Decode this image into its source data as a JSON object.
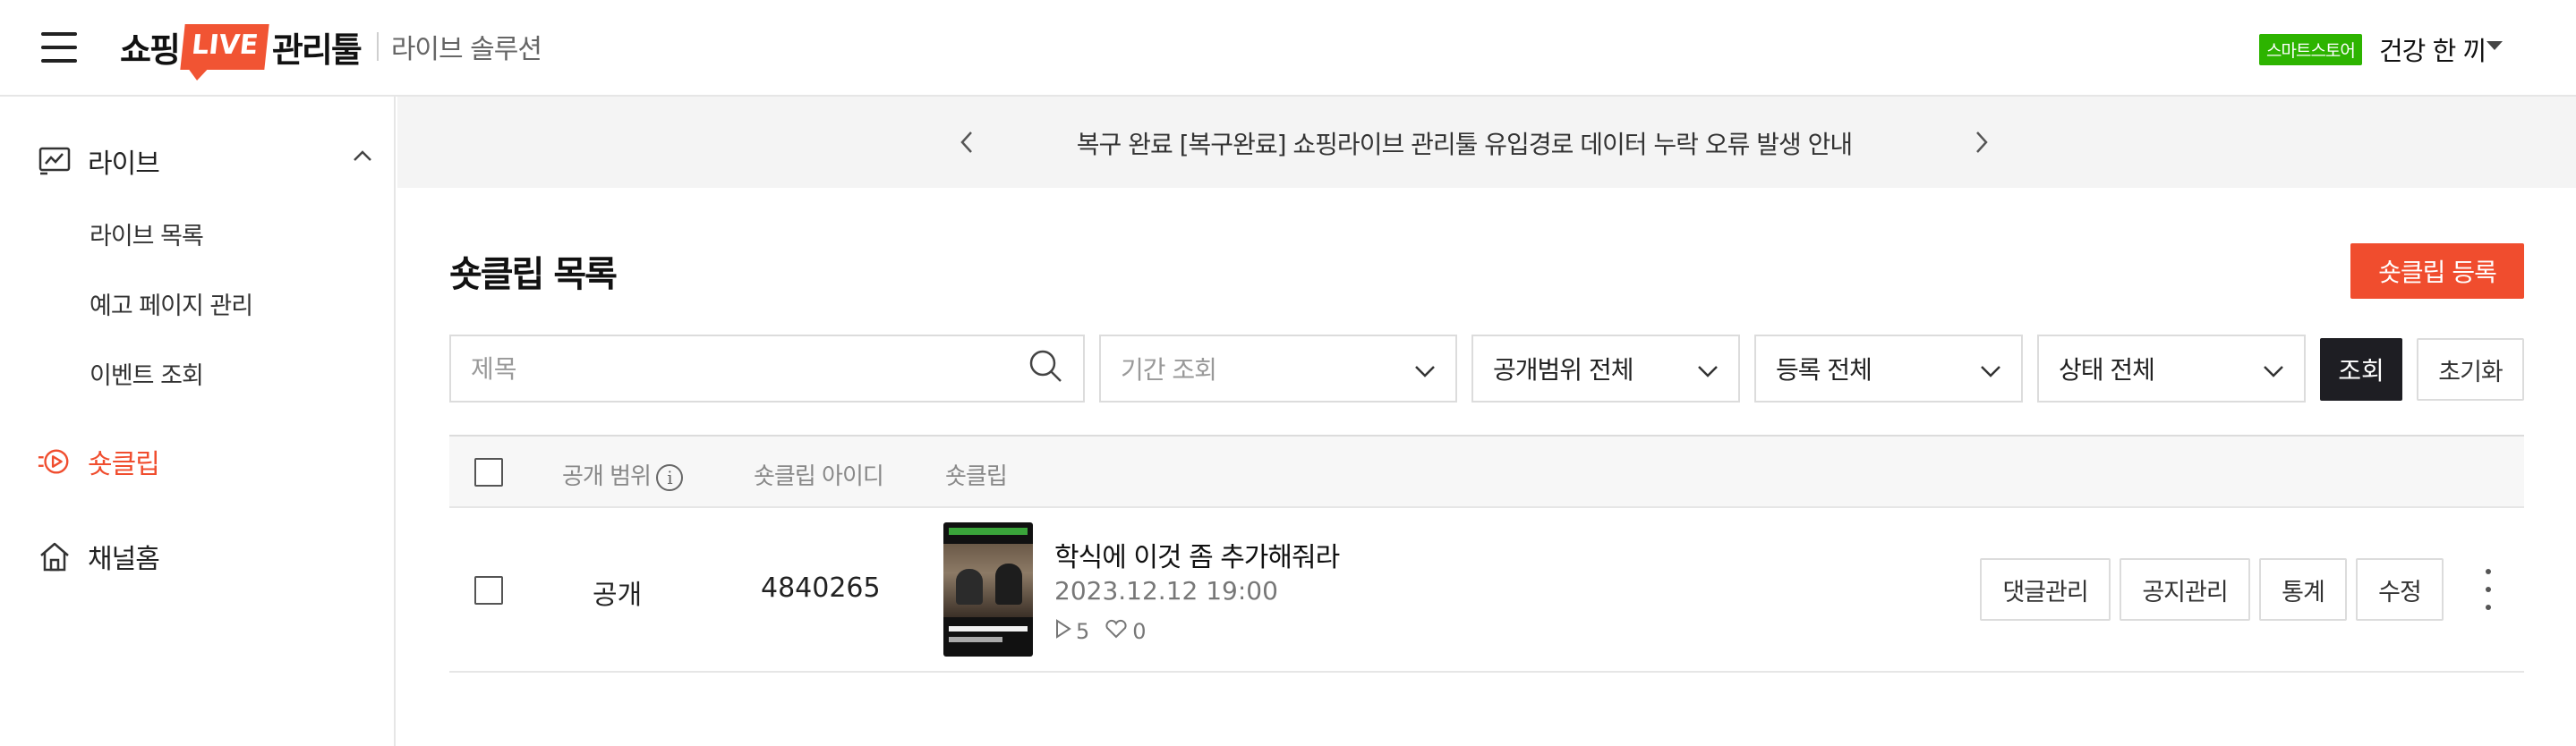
{
  "header": {
    "logo_shop": "쇼핑",
    "logo_live": "LIVE",
    "logo_tool": "관리툴",
    "subtitle": "라이브 솔루션",
    "store_badge": "스마트스토어",
    "store_name": "건강 한 끼"
  },
  "sidebar": {
    "live": {
      "label": "라이브",
      "icon": "chart-monitor-icon"
    },
    "sub_items": [
      "라이브 목록",
      "예고 페이지 관리",
      "이벤트 조회"
    ],
    "shortclip": {
      "label": "숏클립",
      "icon": "play-circle-icon",
      "active": true
    },
    "channel_home": {
      "label": "채널홈",
      "icon": "home-icon"
    }
  },
  "notice": {
    "text": "복구 완료 [복구완료] 쇼핑라이브 관리툴 유입경로 데이터 누락 오류 발생 안내"
  },
  "page": {
    "title": "숏클립 목록",
    "register_button": "숏클립 등록"
  },
  "filters": {
    "search_placeholder": "제목",
    "search_value": "",
    "period": "기간 조회",
    "scope": "공개범위 전체",
    "registration": "등록 전체",
    "status": "상태 전체",
    "query_button": "조회",
    "reset_button": "초기화"
  },
  "table": {
    "columns": [
      "공개 범위",
      "숏클립 아이디",
      "숏클립"
    ],
    "rows": [
      {
        "scope": "공개",
        "id": "4840265",
        "title": "학식에 이것 좀 추가해줘라",
        "date": "2023.12.12 19:00",
        "plays": "5",
        "likes": "0",
        "actions": [
          "댓글관리",
          "공지관리",
          "통계",
          "수정"
        ]
      }
    ]
  },
  "colors": {
    "accent": "#f04d2e",
    "store_badge": "#2db400",
    "dark_button": "#1e1e23"
  }
}
